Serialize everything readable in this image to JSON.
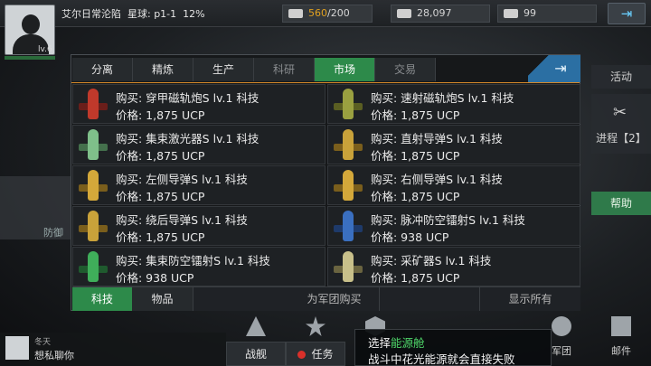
{
  "player": {
    "name": "艾尔日常沦陷",
    "planet_label": "星球: p1-1",
    "progress": "12%",
    "level": "lv.6"
  },
  "resources": [
    {
      "icon": "truck-icon",
      "current": "560",
      "max": "/200"
    },
    {
      "icon": "credits-icon",
      "value": "28,097"
    },
    {
      "icon": "card-icon",
      "value": "99"
    }
  ],
  "side_menu": {
    "activity": "活动",
    "progress": "进程【2】",
    "help": "帮助"
  },
  "left_ghost_label": "防御",
  "tabs": [
    {
      "label": "分离",
      "state": "normal"
    },
    {
      "label": "精炼",
      "state": "normal"
    },
    {
      "label": "生产",
      "state": "normal"
    },
    {
      "label": "科研",
      "state": "dim"
    },
    {
      "label": "市场",
      "state": "active"
    },
    {
      "label": "交易",
      "state": "dim"
    }
  ],
  "items": [
    {
      "line1": "购买: 穿甲磁轨炮S lv.1 科技",
      "line2": "价格: 1,875 UCP",
      "color": "#c0392b"
    },
    {
      "line1": "购买: 速射磁轨炮S lv.1 科技",
      "line2": "价格: 1,875 UCP",
      "color": "#9aa040"
    },
    {
      "line1": "购买: 集束激光器S lv.1 科技",
      "line2": "价格: 1,875 UCP",
      "color": "#7fbf8a"
    },
    {
      "line1": "购买: 直射导弹S lv.1 科技",
      "line2": "价格: 1,875 UCP",
      "color": "#c9a23a"
    },
    {
      "line1": "购买: 左侧导弹S lv.1 科技",
      "line2": "价格: 1,875 UCP",
      "color": "#d4a83a"
    },
    {
      "line1": "购买: 右侧导弹S lv.1 科技",
      "line2": "价格: 1,875 UCP",
      "color": "#d4a83a"
    },
    {
      "line1": "购买: 绕后导弹S lv.1 科技",
      "line2": "价格: 1,875 UCP",
      "color": "#c9a23a"
    },
    {
      "line1": "购买: 脉冲防空镭射S lv.1 科技",
      "line2": "价格: 938 UCP",
      "color": "#3a6fc0"
    },
    {
      "line1": "购买: 集束防空镭射S lv.1 科技",
      "line2": "价格: 938 UCP",
      "color": "#3fae5a"
    },
    {
      "line1": "购买: 采矿器S lv.1 科技",
      "line2": "价格: 1,875 UCP",
      "color": "#c8c08a"
    }
  ],
  "bottom_tabs": {
    "tech": "科技",
    "goods": "物品",
    "corps_buy": "为军团购买",
    "show_all": "显示所有"
  },
  "chat": {
    "name": "冬天",
    "message": "想私聊你"
  },
  "nav": {
    "ships": "战舰",
    "missions": "任务",
    "corps": "军团",
    "mail": "邮件"
  },
  "tip": {
    "prefix": "选择",
    "highlight": "能源舱",
    "line2": "战斗中花光能源就会直接失败"
  }
}
